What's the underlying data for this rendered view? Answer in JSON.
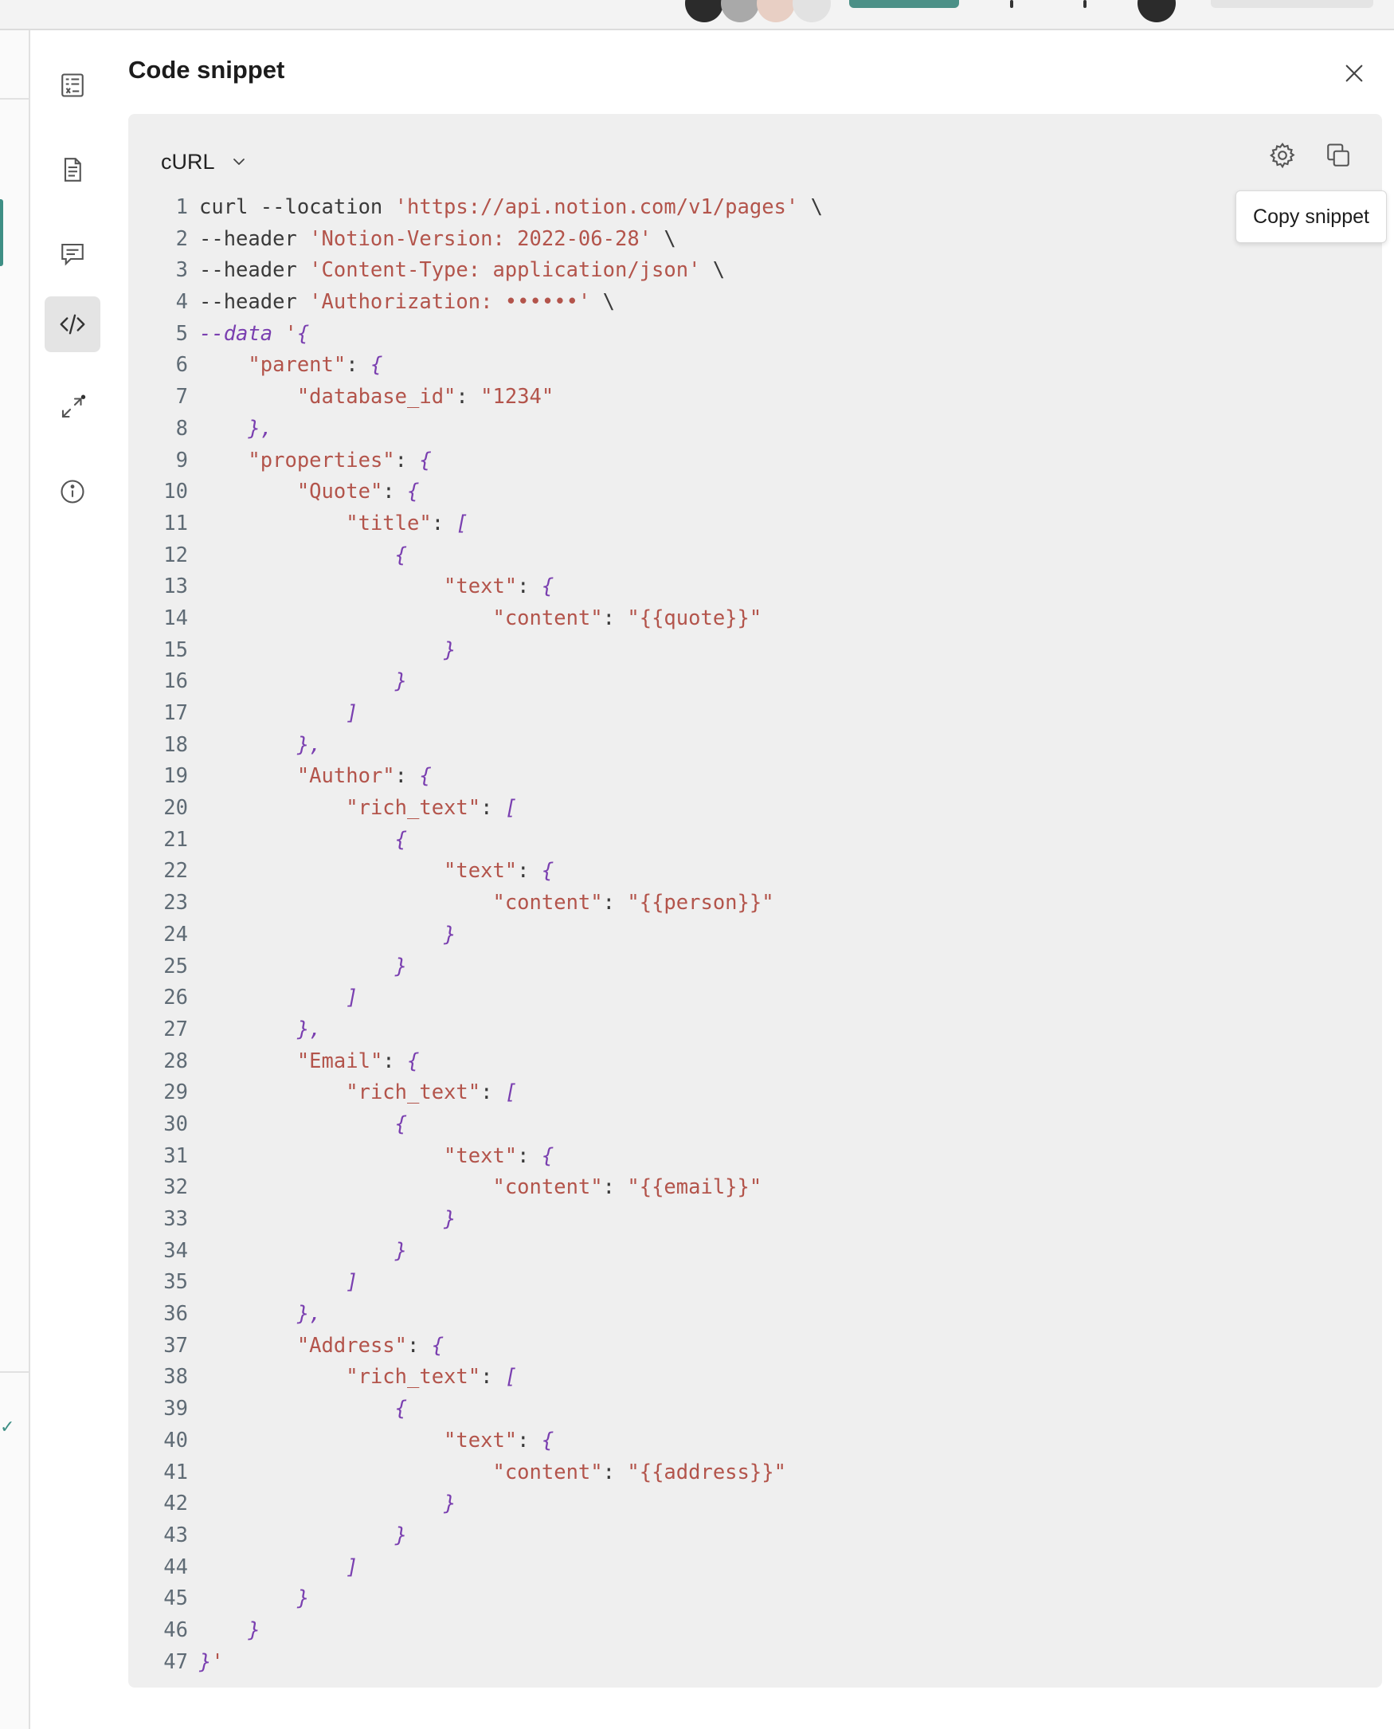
{
  "panel": {
    "title": "Code snippet"
  },
  "snippet": {
    "language": "cURL",
    "tooltip": "Copy snippet",
    "lines": [
      [
        [
          "p",
          "curl --location "
        ],
        [
          "s",
          "'https://api.notion.com/v1/pages'"
        ],
        [
          "p",
          " \\"
        ]
      ],
      [
        [
          "p",
          "--header "
        ],
        [
          "s",
          "'Notion-Version: 2022-06-28'"
        ],
        [
          "p",
          " \\"
        ]
      ],
      [
        [
          "p",
          "--header "
        ],
        [
          "s",
          "'Content-Type: application/json'"
        ],
        [
          "p",
          " \\"
        ]
      ],
      [
        [
          "p",
          "--header "
        ],
        [
          "s",
          "'Authorization: ••••••'"
        ],
        [
          "p",
          " \\"
        ]
      ],
      [
        [
          "k",
          "--data "
        ],
        [
          "s",
          "'"
        ],
        [
          "k",
          "{"
        ]
      ],
      [
        [
          "p",
          "    "
        ],
        [
          "s",
          "\"parent\""
        ],
        [
          "p",
          ": "
        ],
        [
          "k",
          "{"
        ]
      ],
      [
        [
          "p",
          "        "
        ],
        [
          "s",
          "\"database_id\""
        ],
        [
          "p",
          ": "
        ],
        [
          "s",
          "\"1234\""
        ]
      ],
      [
        [
          "p",
          "    "
        ],
        [
          "k",
          "},"
        ]
      ],
      [
        [
          "p",
          "    "
        ],
        [
          "s",
          "\"properties\""
        ],
        [
          "p",
          ": "
        ],
        [
          "k",
          "{"
        ]
      ],
      [
        [
          "p",
          "        "
        ],
        [
          "s",
          "\"Quote\""
        ],
        [
          "p",
          ": "
        ],
        [
          "k",
          "{"
        ]
      ],
      [
        [
          "p",
          "            "
        ],
        [
          "s",
          "\"title\""
        ],
        [
          "p",
          ": "
        ],
        [
          "k",
          "["
        ]
      ],
      [
        [
          "p",
          "                "
        ],
        [
          "k",
          "{"
        ]
      ],
      [
        [
          "p",
          "                    "
        ],
        [
          "s",
          "\"text\""
        ],
        [
          "p",
          ": "
        ],
        [
          "k",
          "{"
        ]
      ],
      [
        [
          "p",
          "                        "
        ],
        [
          "s",
          "\"content\""
        ],
        [
          "p",
          ": "
        ],
        [
          "s",
          "\"{{quote}}\""
        ]
      ],
      [
        [
          "p",
          "                    "
        ],
        [
          "k",
          "}"
        ]
      ],
      [
        [
          "p",
          "                "
        ],
        [
          "k",
          "}"
        ]
      ],
      [
        [
          "p",
          "            "
        ],
        [
          "k",
          "]"
        ]
      ],
      [
        [
          "p",
          "        "
        ],
        [
          "k",
          "},"
        ]
      ],
      [
        [
          "p",
          "        "
        ],
        [
          "s",
          "\"Author\""
        ],
        [
          "p",
          ": "
        ],
        [
          "k",
          "{"
        ]
      ],
      [
        [
          "p",
          "            "
        ],
        [
          "s",
          "\"rich_text\""
        ],
        [
          "p",
          ": "
        ],
        [
          "k",
          "["
        ]
      ],
      [
        [
          "p",
          "                "
        ],
        [
          "k",
          "{"
        ]
      ],
      [
        [
          "p",
          "                    "
        ],
        [
          "s",
          "\"text\""
        ],
        [
          "p",
          ": "
        ],
        [
          "k",
          "{"
        ]
      ],
      [
        [
          "p",
          "                        "
        ],
        [
          "s",
          "\"content\""
        ],
        [
          "p",
          ": "
        ],
        [
          "s",
          "\"{{person}}\""
        ]
      ],
      [
        [
          "p",
          "                    "
        ],
        [
          "k",
          "}"
        ]
      ],
      [
        [
          "p",
          "                "
        ],
        [
          "k",
          "}"
        ]
      ],
      [
        [
          "p",
          "            "
        ],
        [
          "k",
          "]"
        ]
      ],
      [
        [
          "p",
          "        "
        ],
        [
          "k",
          "},"
        ]
      ],
      [
        [
          "p",
          "        "
        ],
        [
          "s",
          "\"Email\""
        ],
        [
          "p",
          ": "
        ],
        [
          "k",
          "{"
        ]
      ],
      [
        [
          "p",
          "            "
        ],
        [
          "s",
          "\"rich_text\""
        ],
        [
          "p",
          ": "
        ],
        [
          "k",
          "["
        ]
      ],
      [
        [
          "p",
          "                "
        ],
        [
          "k",
          "{"
        ]
      ],
      [
        [
          "p",
          "                    "
        ],
        [
          "s",
          "\"text\""
        ],
        [
          "p",
          ": "
        ],
        [
          "k",
          "{"
        ]
      ],
      [
        [
          "p",
          "                        "
        ],
        [
          "s",
          "\"content\""
        ],
        [
          "p",
          ": "
        ],
        [
          "s",
          "\"{{email}}\""
        ]
      ],
      [
        [
          "p",
          "                    "
        ],
        [
          "k",
          "}"
        ]
      ],
      [
        [
          "p",
          "                "
        ],
        [
          "k",
          "}"
        ]
      ],
      [
        [
          "p",
          "            "
        ],
        [
          "k",
          "]"
        ]
      ],
      [
        [
          "p",
          "        "
        ],
        [
          "k",
          "},"
        ]
      ],
      [
        [
          "p",
          "        "
        ],
        [
          "s",
          "\"Address\""
        ],
        [
          "p",
          ": "
        ],
        [
          "k",
          "{"
        ]
      ],
      [
        [
          "p",
          "            "
        ],
        [
          "s",
          "\"rich_text\""
        ],
        [
          "p",
          ": "
        ],
        [
          "k",
          "["
        ]
      ],
      [
        [
          "p",
          "                "
        ],
        [
          "k",
          "{"
        ]
      ],
      [
        [
          "p",
          "                    "
        ],
        [
          "s",
          "\"text\""
        ],
        [
          "p",
          ": "
        ],
        [
          "k",
          "{"
        ]
      ],
      [
        [
          "p",
          "                        "
        ],
        [
          "s",
          "\"content\""
        ],
        [
          "p",
          ": "
        ],
        [
          "s",
          "\"{{address}}\""
        ]
      ],
      [
        [
          "p",
          "                    "
        ],
        [
          "k",
          "}"
        ]
      ],
      [
        [
          "p",
          "                "
        ],
        [
          "k",
          "}"
        ]
      ],
      [
        [
          "p",
          "            "
        ],
        [
          "k",
          "]"
        ]
      ],
      [
        [
          "p",
          "        "
        ],
        [
          "k",
          "}"
        ]
      ],
      [
        [
          "p",
          "    "
        ],
        [
          "k",
          "}"
        ]
      ],
      [
        [
          "k",
          "}"
        ],
        [
          "s",
          "'"
        ]
      ]
    ]
  },
  "icons": {
    "rail": [
      "variables-icon",
      "document-icon",
      "comment-icon",
      "code-icon",
      "expand-arrows-icon",
      "info-icon"
    ],
    "active_rail": "code-icon"
  },
  "colors": {
    "accent": "#3e8f85",
    "code_bg": "#efefef",
    "string": "#b3544b",
    "punct": "#7a3fb0",
    "line_number": "#5f6b75"
  }
}
